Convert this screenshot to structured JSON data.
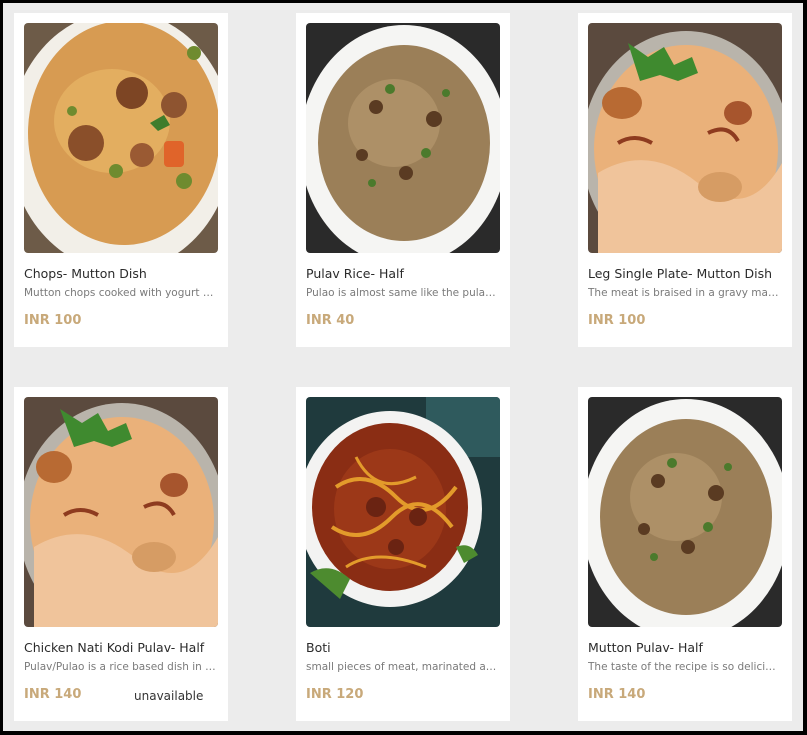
{
  "menu": {
    "items": [
      {
        "title": "Chops- Mutton Dish",
        "description": "Mutton chops cooked with yogurt and spices",
        "price": "INR 100",
        "status": "",
        "image": "mutton-veg-pulao-image"
      },
      {
        "title": "Pulav Rice- Half",
        "description": "Pulao is almost same like the pulao rice",
        "price": "INR 40",
        "status": "",
        "image": "brown-pulao-plate-image"
      },
      {
        "title": "Leg Single Plate- Mutton Dish",
        "description": "The meat is braised in a gravy made with spices",
        "price": "INR 100",
        "status": "",
        "image": "biryani-plate-image"
      },
      {
        "title": "Chicken Nati Kodi Pulav- Half",
        "description": "Pulav/Pulao is a rice based dish in which",
        "price": "INR 140",
        "status": "unavailable",
        "image": "biryani-plate-image"
      },
      {
        "title": "Boti",
        "description": "small pieces of meat, marinated and cooked",
        "price": "INR 120",
        "status": "",
        "image": "boti-curry-bowl-image"
      },
      {
        "title": "Mutton Pulav- Half",
        "description": "The taste of the recipe is so delicious and rich",
        "price": "INR 140",
        "status": "",
        "image": "brown-pulao-plate-image"
      }
    ]
  }
}
